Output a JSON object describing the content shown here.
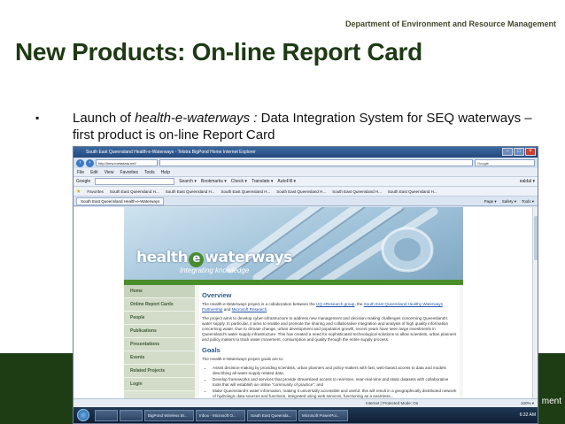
{
  "slide": {
    "department": "Department of Environment and Resource Management",
    "title": "New Products: On-line Report Card",
    "bullet_symbol": "▪",
    "bullet_text_pre": "Launch of ",
    "bullet_text_italic": "health-e-waterways : ",
    "bullet_text_post": "Data Integration System for SEQ waterways – first product is on-line Report Card",
    "footer_partial": "ment"
  },
  "browser": {
    "window_title": "South East Queensland Health-e-Waterways - Telstra BigPond Home Internet Explorer",
    "url": "http://hew.metadata.net/",
    "search_placeholder": "Google",
    "menu": [
      "File",
      "Edit",
      "View",
      "Favorites",
      "Tools",
      "Help"
    ],
    "google_bar": {
      "label": "Google",
      "search": "Search ▾",
      "bookmarks": "Bookmarks ▾",
      "check": "Check ▾",
      "translate": "Translate ▾",
      "autofill": "AutoFill ▾",
      "user": "ealdal ▾"
    },
    "favorites_label": "Favorites",
    "favorites": [
      "South East Queensland H...",
      "South East Queensland H...",
      "South East Queensland H...",
      "South East Queensland H...",
      "South East Queensland H...",
      "South East Queensland H..."
    ],
    "active_tab": "South East Queensland Health-e-Waterways",
    "tab_tools": {
      "page": "Page ▾",
      "safety": "Safety ▾",
      "tools": "Tools ▾"
    },
    "status_zone": "Internet | Protected Mode: On",
    "zoom": "100% ▾"
  },
  "site": {
    "logo_pre": "health",
    "logo_e": "e",
    "logo_post": "waterways",
    "tagline": "Integrating knowledge",
    "nav": [
      "Home",
      "Online Report Cards",
      "People",
      "Publications",
      "Presentations",
      "Events",
      "Related Projects",
      "Login"
    ],
    "overview_heading": "Overview",
    "overview_p1_a": "The Health-e-Waterways project is a collaboration between the ",
    "overview_p1_link1": "UQ eResearch group",
    "overview_p1_b": ", the ",
    "overview_p1_link2": "South East Queensland Healthy Waterways Partnership",
    "overview_p1_c": " and ",
    "overview_p1_link3": "Microsoft Research",
    "overview_p1_d": ".",
    "overview_p2": "The project aims to develop cyber-infrastructure to address new management and decision-making challenges concerning Queensland's water supply. In particular, it aims to enable and promote the sharing and collaborative integration and analysis of high quality information concerning water. Due to climate change, urban development and population growth, recent years have seen large investments in Queensland's water supply infrastructure. This has created a need for sophisticated technological solutions to allow scientists, urban planners and policy makers to track water movement, consumption and quality through the entire supply process.",
    "goals_heading": "Goals",
    "goals_intro": "The Health-e-Waterways project goals are to:",
    "goals": [
      "Assist decision-making by providing scientists, urban planners and policy-makers with fast, web-based access to data and models describing all water-supply related data.",
      "Develop frameworks and services that provide streamlined access to real-time, near-real-time and static datasets with collaborative tools that will establish an online \"community of practice\"; and",
      "Make Queensland's water information, making it universally accessible and useful: this will result in a geographically distributed network of hydrologic data sources and functions, integrated using web services, functioning as a seamless..."
    ]
  },
  "taskbar": {
    "items": [
      "",
      "",
      "BigPond Wireless Br...",
      "Inbox - Microsoft O...",
      "South East Queensla...",
      "Microsoft PowerPoi..."
    ],
    "clock": "6:32 AM"
  }
}
